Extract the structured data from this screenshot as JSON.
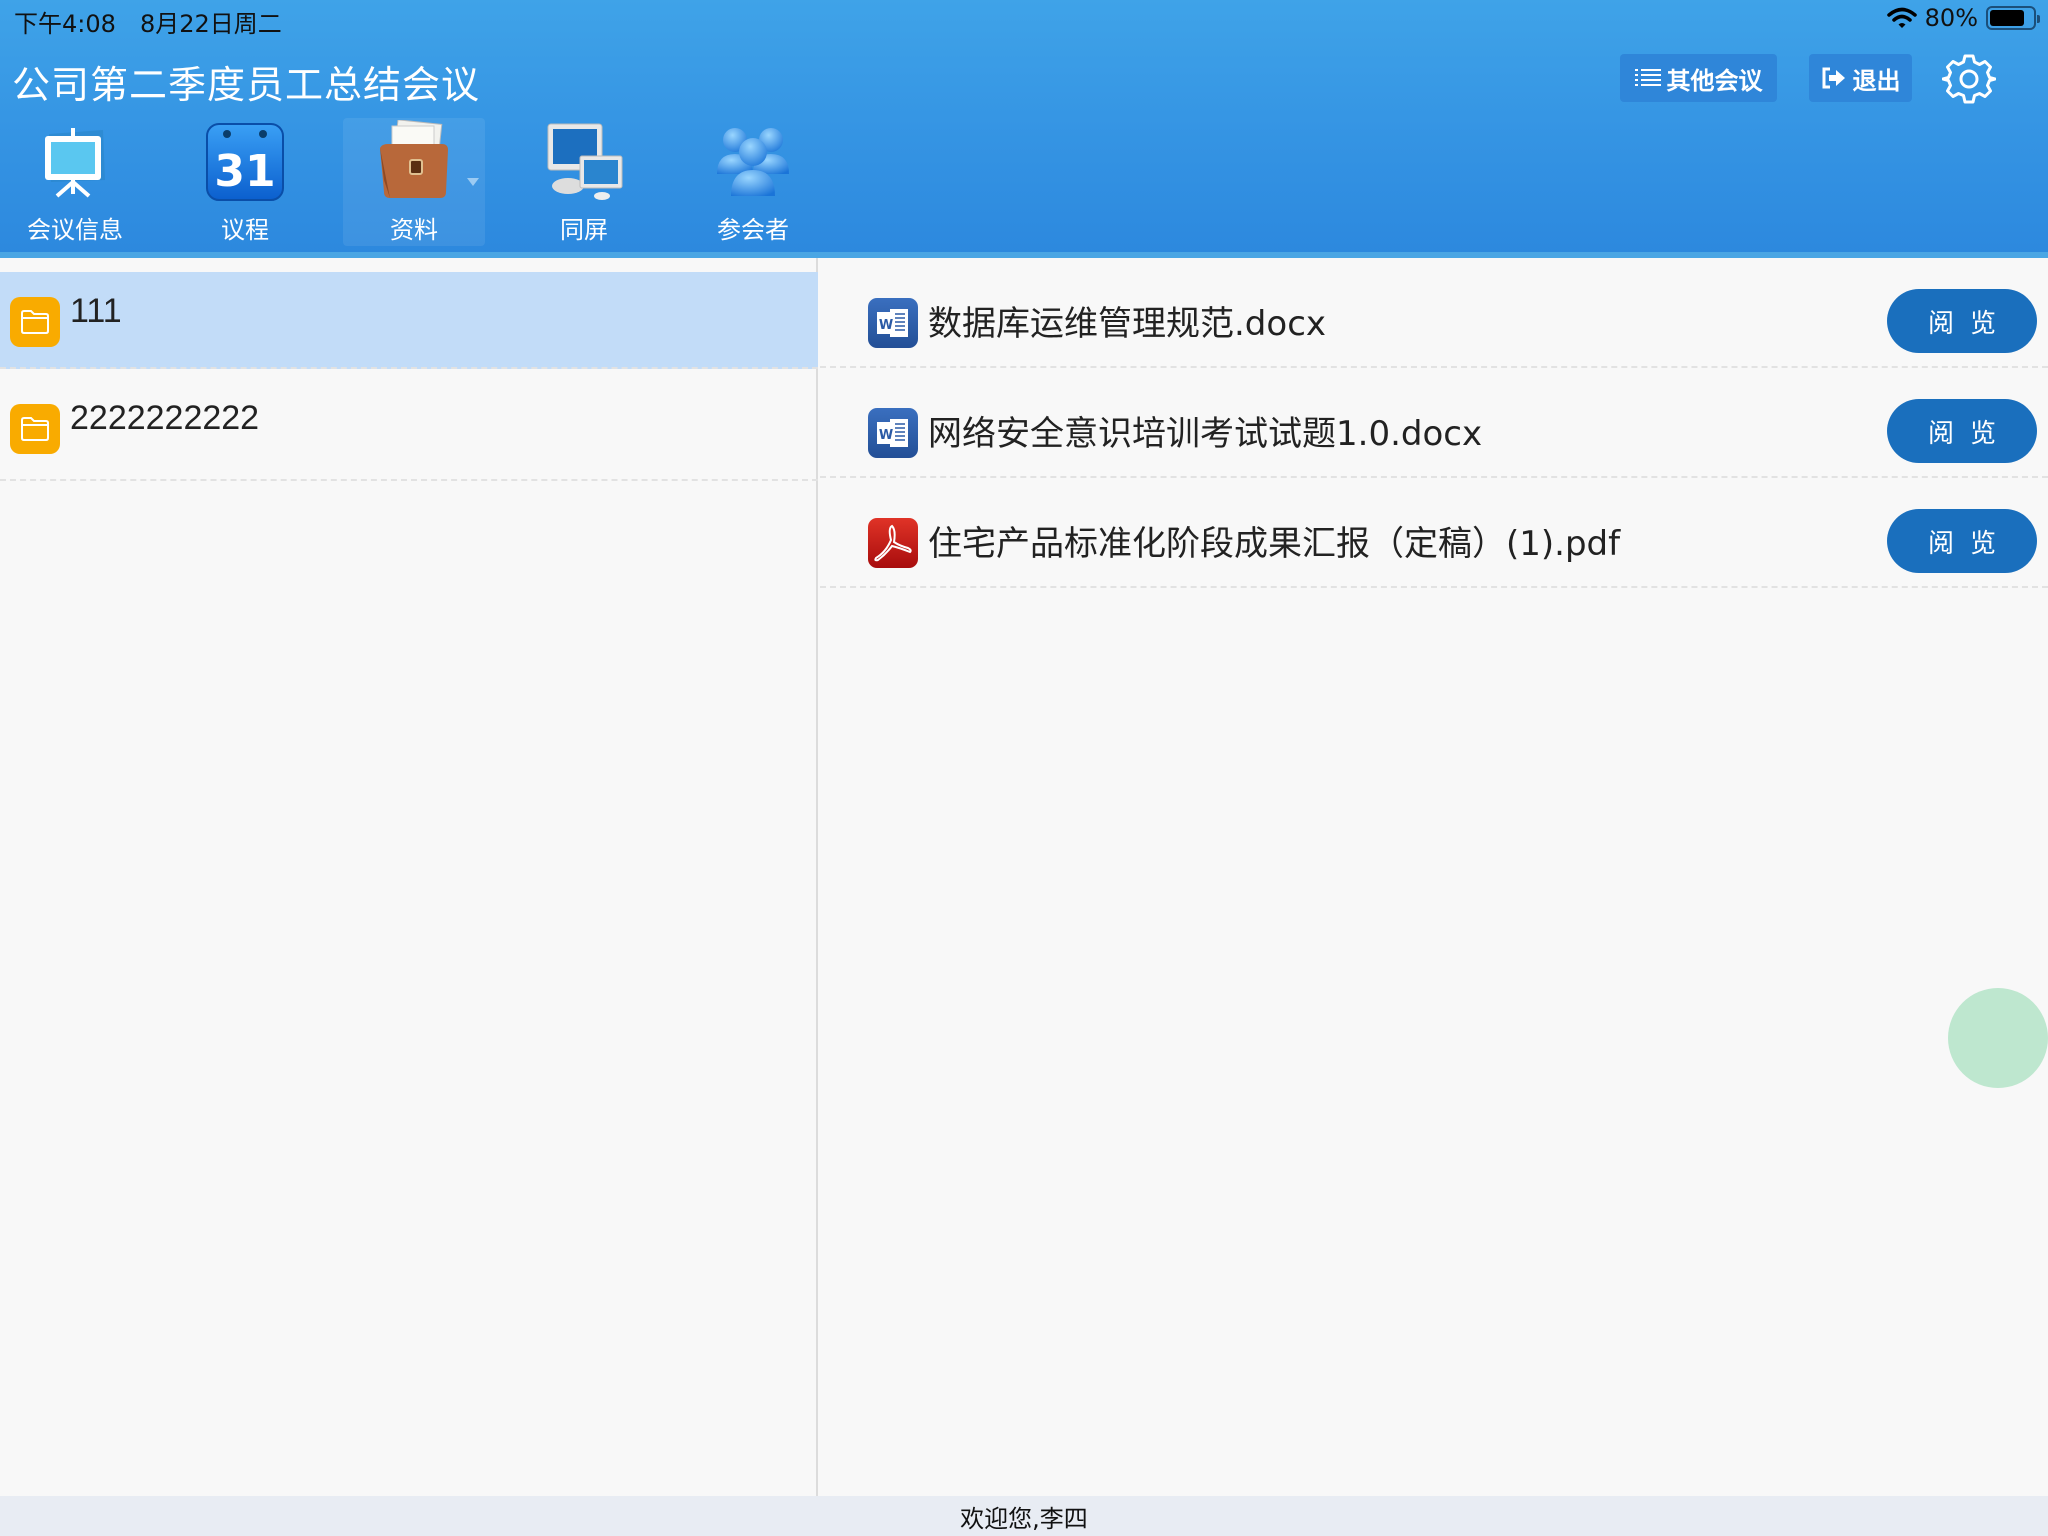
{
  "status_bar": {
    "time": "下午4:08",
    "date": "8月22日周二",
    "battery": "80%",
    "battery_level": 0.8,
    "wifi_icon": "wifi-icon",
    "battery_icon": "battery-icon"
  },
  "header": {
    "title": "公司第二季度员工总结会议",
    "other_meetings_label": "其他会议",
    "other_meetings_icon": "list-icon",
    "exit_label": "退出",
    "exit_icon": "logout-icon",
    "settings_icon": "gear-icon"
  },
  "nav": {
    "items": [
      {
        "label": "会议信息",
        "icon": "projector-board-icon",
        "active": false
      },
      {
        "label": "议程",
        "icon": "calendar-icon",
        "icon_text": "31",
        "active": false
      },
      {
        "label": "资料",
        "icon": "briefcase-icon",
        "active": true,
        "has_dropdown": true
      },
      {
        "label": "同屏",
        "icon": "screen-share-icon",
        "active": false
      },
      {
        "label": "参会者",
        "icon": "attendees-icon",
        "active": false
      }
    ]
  },
  "folders": [
    {
      "name": "111",
      "selected": true,
      "icon": "folder-icon"
    },
    {
      "name": "2222222222",
      "selected": false,
      "icon": "folder-icon"
    }
  ],
  "files": [
    {
      "name": "数据库运维管理规范.docx",
      "type": "word",
      "icon": "word-file-icon",
      "action": "阅览"
    },
    {
      "name": "网络安全意识培训考试试题1.0.docx",
      "type": "word",
      "icon": "word-file-icon",
      "action": "阅览"
    },
    {
      "name": "住宅产品标准化阶段成果汇报（定稿）(1).pdf",
      "type": "pdf",
      "icon": "pdf-file-icon",
      "action": "阅览"
    }
  ],
  "footer": {
    "welcome": "欢迎您,李四"
  },
  "colors": {
    "header": "#3696e4",
    "selected_row": "#c2dcf8",
    "view_button": "#1a6fbd",
    "folder": "#f9ab00",
    "float_button": "#bee7cf"
  }
}
